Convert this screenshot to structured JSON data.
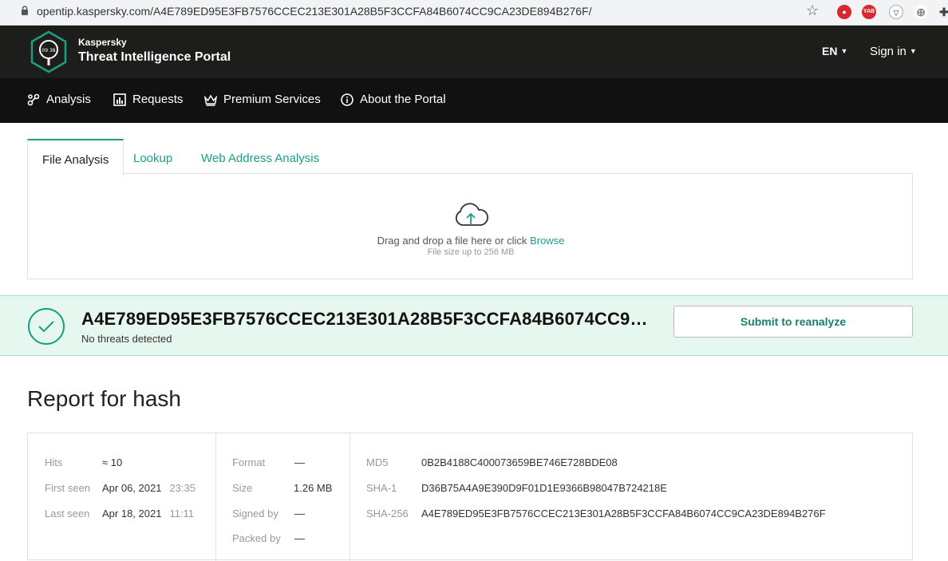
{
  "browser": {
    "url": "opentip.kaspersky.com/A4E789ED95E3FB7576CCEC213E301A28B5F3CCFA84B6074CC9CA23DE894B276F/",
    "ext_yab": "YAB"
  },
  "header": {
    "brand_small": "Kaspersky",
    "brand_big": "Threat Intelligence Portal",
    "lang": "EN",
    "signin": "Sign in"
  },
  "nav": {
    "items": [
      {
        "label": "Analysis"
      },
      {
        "label": "Requests"
      },
      {
        "label": "Premium Services"
      },
      {
        "label": "About the Portal"
      }
    ]
  },
  "tabs": [
    {
      "label": "File Analysis"
    },
    {
      "label": "Lookup"
    },
    {
      "label": "Web Address Analysis"
    }
  ],
  "upload": {
    "drag_text": "Drag and drop a file here or click",
    "browse": "Browse",
    "size_text": "File size up to 256 MB"
  },
  "result": {
    "hash": "A4E789ED95E3FB7576CCEC213E301A28B5F3CCFA84B6074CC9CA23DE894B276F",
    "status": "No threats detected",
    "reanalyze": "Submit to reanalyze"
  },
  "report": {
    "title": "Report for hash",
    "hits_label": "Hits",
    "hits_value": "≈ 10",
    "first_seen_label": "First seen",
    "first_seen_date": "Apr 06, 2021",
    "first_seen_time": "23:35",
    "last_seen_label": "Last seen",
    "last_seen_date": "Apr 18, 2021",
    "last_seen_time": "11:11",
    "format_label": "Format",
    "format_value": "—",
    "size_label": "Size",
    "size_value": "1.26 MB",
    "signed_label": "Signed by",
    "signed_value": "—",
    "packed_label": "Packed by",
    "packed_value": "—",
    "md5_label": "MD5",
    "md5_value": "0B2B4188C400073659BE746E728BDE08",
    "sha1_label": "SHA-1",
    "sha1_value": "D36B75A4A9E390D9F01D1E9366B98047B724218E",
    "sha256_label": "SHA-256",
    "sha256_value": "A4E789ED95E3FB7576CCEC213E301A28B5F3CCFA84B6074CC9CA23DE894B276F"
  },
  "colors": {
    "accent": "#1c9e85",
    "header_bg": "#1d1d1b",
    "nav_bg": "#111111",
    "result_bg": "#e6f7ef"
  }
}
